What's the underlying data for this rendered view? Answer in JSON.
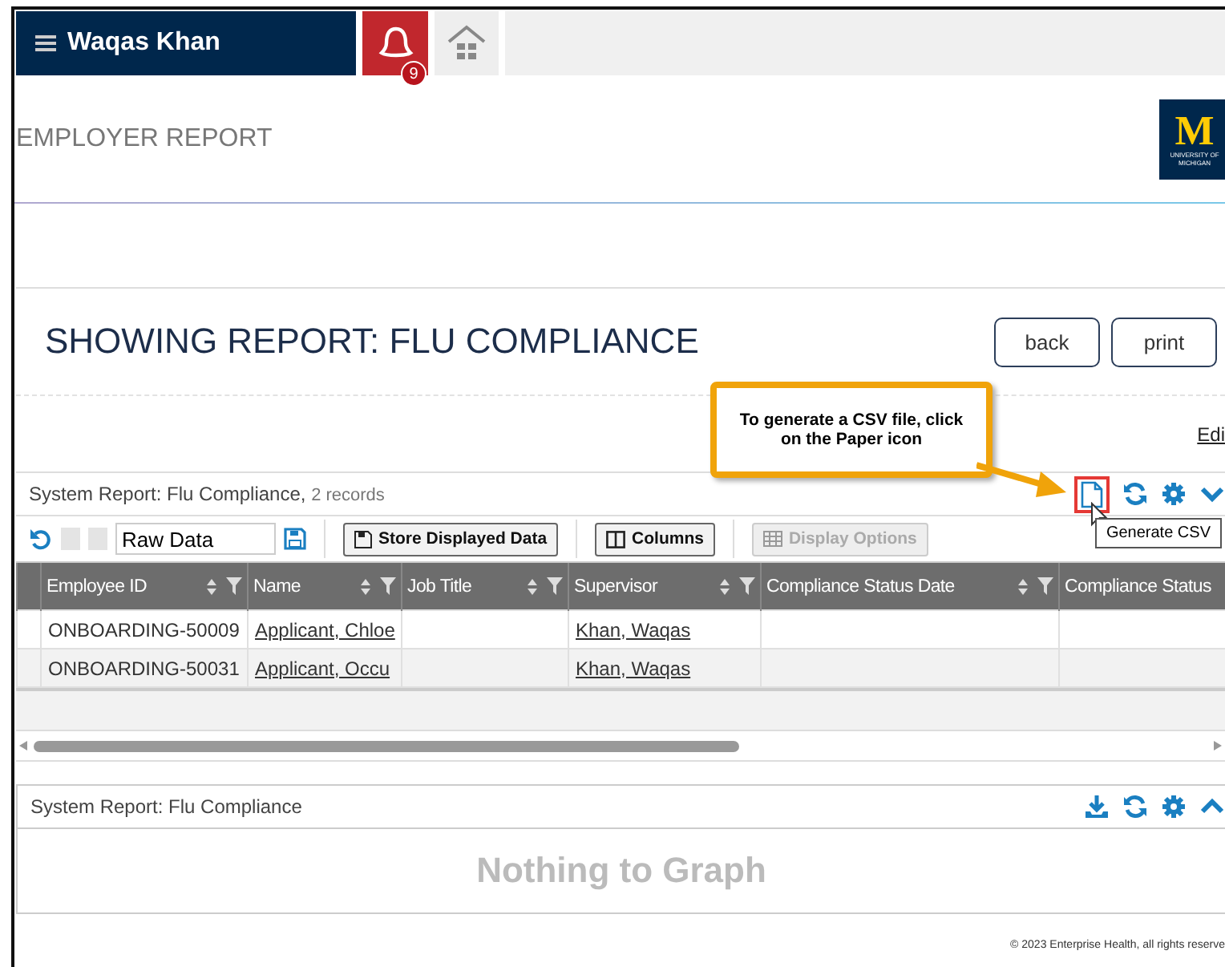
{
  "topbar": {
    "user": "Waqas Khan",
    "notifications": "9"
  },
  "page": {
    "title": "EMPLOYER REPORT",
    "logo": {
      "letter": "M",
      "lines": [
        "UNIVERSITY OF",
        "MICHIGAN"
      ]
    }
  },
  "report": {
    "title": "SHOWING REPORT: FLU COMPLIANCE",
    "buttons": [
      "back",
      "print"
    ],
    "edit_link": "Edi"
  },
  "callout": {
    "text": "To generate a CSV file, click on the Paper icon"
  },
  "grid": {
    "title": "System Report: Flu Compliance,",
    "count": "2 records",
    "tooltip": "Generate CSV",
    "view_name": "Raw Data",
    "toolbar": [
      {
        "label": "Store Displayed Data",
        "disabled": false
      },
      {
        "label": "Columns",
        "disabled": false
      },
      {
        "label": "Display Options",
        "disabled": true
      }
    ],
    "columns": [
      "Employee ID",
      "Name",
      "Job Title",
      "Supervisor",
      "Compliance Status Date",
      "Compliance Status"
    ],
    "rows": [
      [
        "ONBOARDING-50009",
        "Applicant, Chloe",
        "",
        "Khan, Waqas",
        "",
        ""
      ],
      [
        "ONBOARDING-50031",
        "Applicant, Occu",
        "",
        "Khan, Waqas",
        "",
        ""
      ]
    ]
  },
  "chart_panel": {
    "title": "System Report: Flu Compliance",
    "empty": "Nothing to Graph"
  },
  "footer": "© 2023 Enterprise Health, all rights reserve"
}
